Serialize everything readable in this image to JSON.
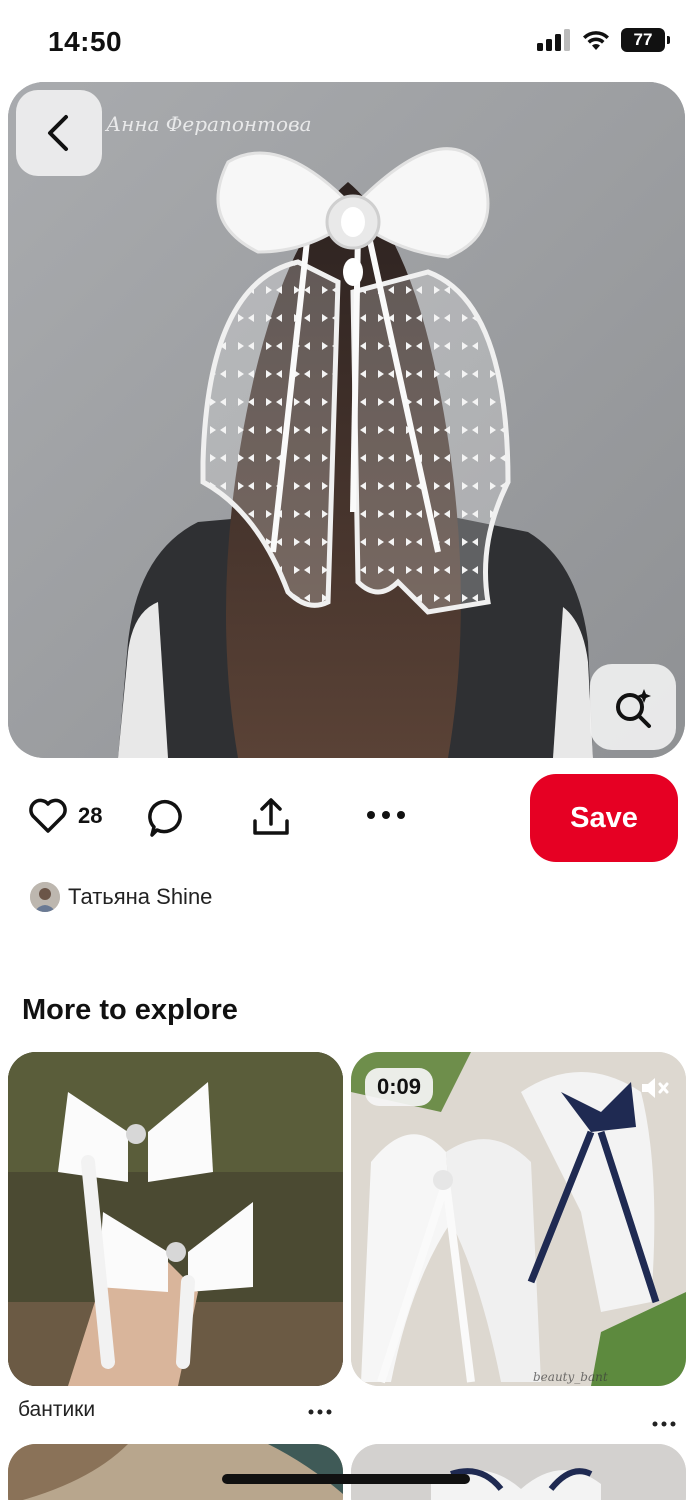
{
  "status_bar": {
    "time": "14:50",
    "battery": "77"
  },
  "pin": {
    "watermark": "Анна Ферапонтова",
    "like_count": "28",
    "save_label": "Save",
    "author_name": "Татьяна Shine"
  },
  "explore": {
    "title": "More to explore",
    "cards": [
      {
        "caption": "бантики"
      },
      {
        "video_duration": "0:09",
        "watermark": "beauty_bant"
      }
    ]
  },
  "icons": {
    "back": "chevron-left-icon",
    "lens": "visual-search-icon",
    "like": "heart-icon",
    "comment": "comment-icon",
    "share": "share-icon",
    "more": "more-icon",
    "mute": "muted-speaker-icon"
  },
  "colors": {
    "save_button": "#e60023"
  }
}
